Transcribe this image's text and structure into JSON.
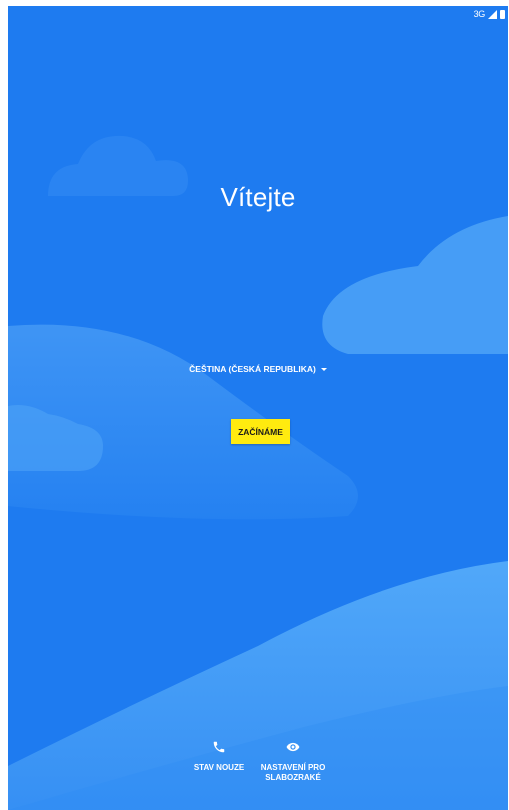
{
  "status_bar": {
    "network": "3G",
    "icons": [
      "signal-icon",
      "battery-icon"
    ]
  },
  "welcome": {
    "title": "Vítejte"
  },
  "language": {
    "selected": "ČEŠTINA (ČESKÁ REPUBLIKA)",
    "icon": "dropdown-arrow-icon"
  },
  "start_button": {
    "label": "ZAČÍNÁME"
  },
  "bottom_actions": {
    "emergency": {
      "label": "STAV NOUZE",
      "icon": "phone-icon"
    },
    "accessibility": {
      "label_line1": "NASTAVENÍ PRO",
      "label_line2": "SLABOZRAKÉ",
      "icon": "eye-icon"
    }
  },
  "colors": {
    "background": "#1e7bf0",
    "button": "#ffeb0f",
    "text": "#ffffff"
  }
}
